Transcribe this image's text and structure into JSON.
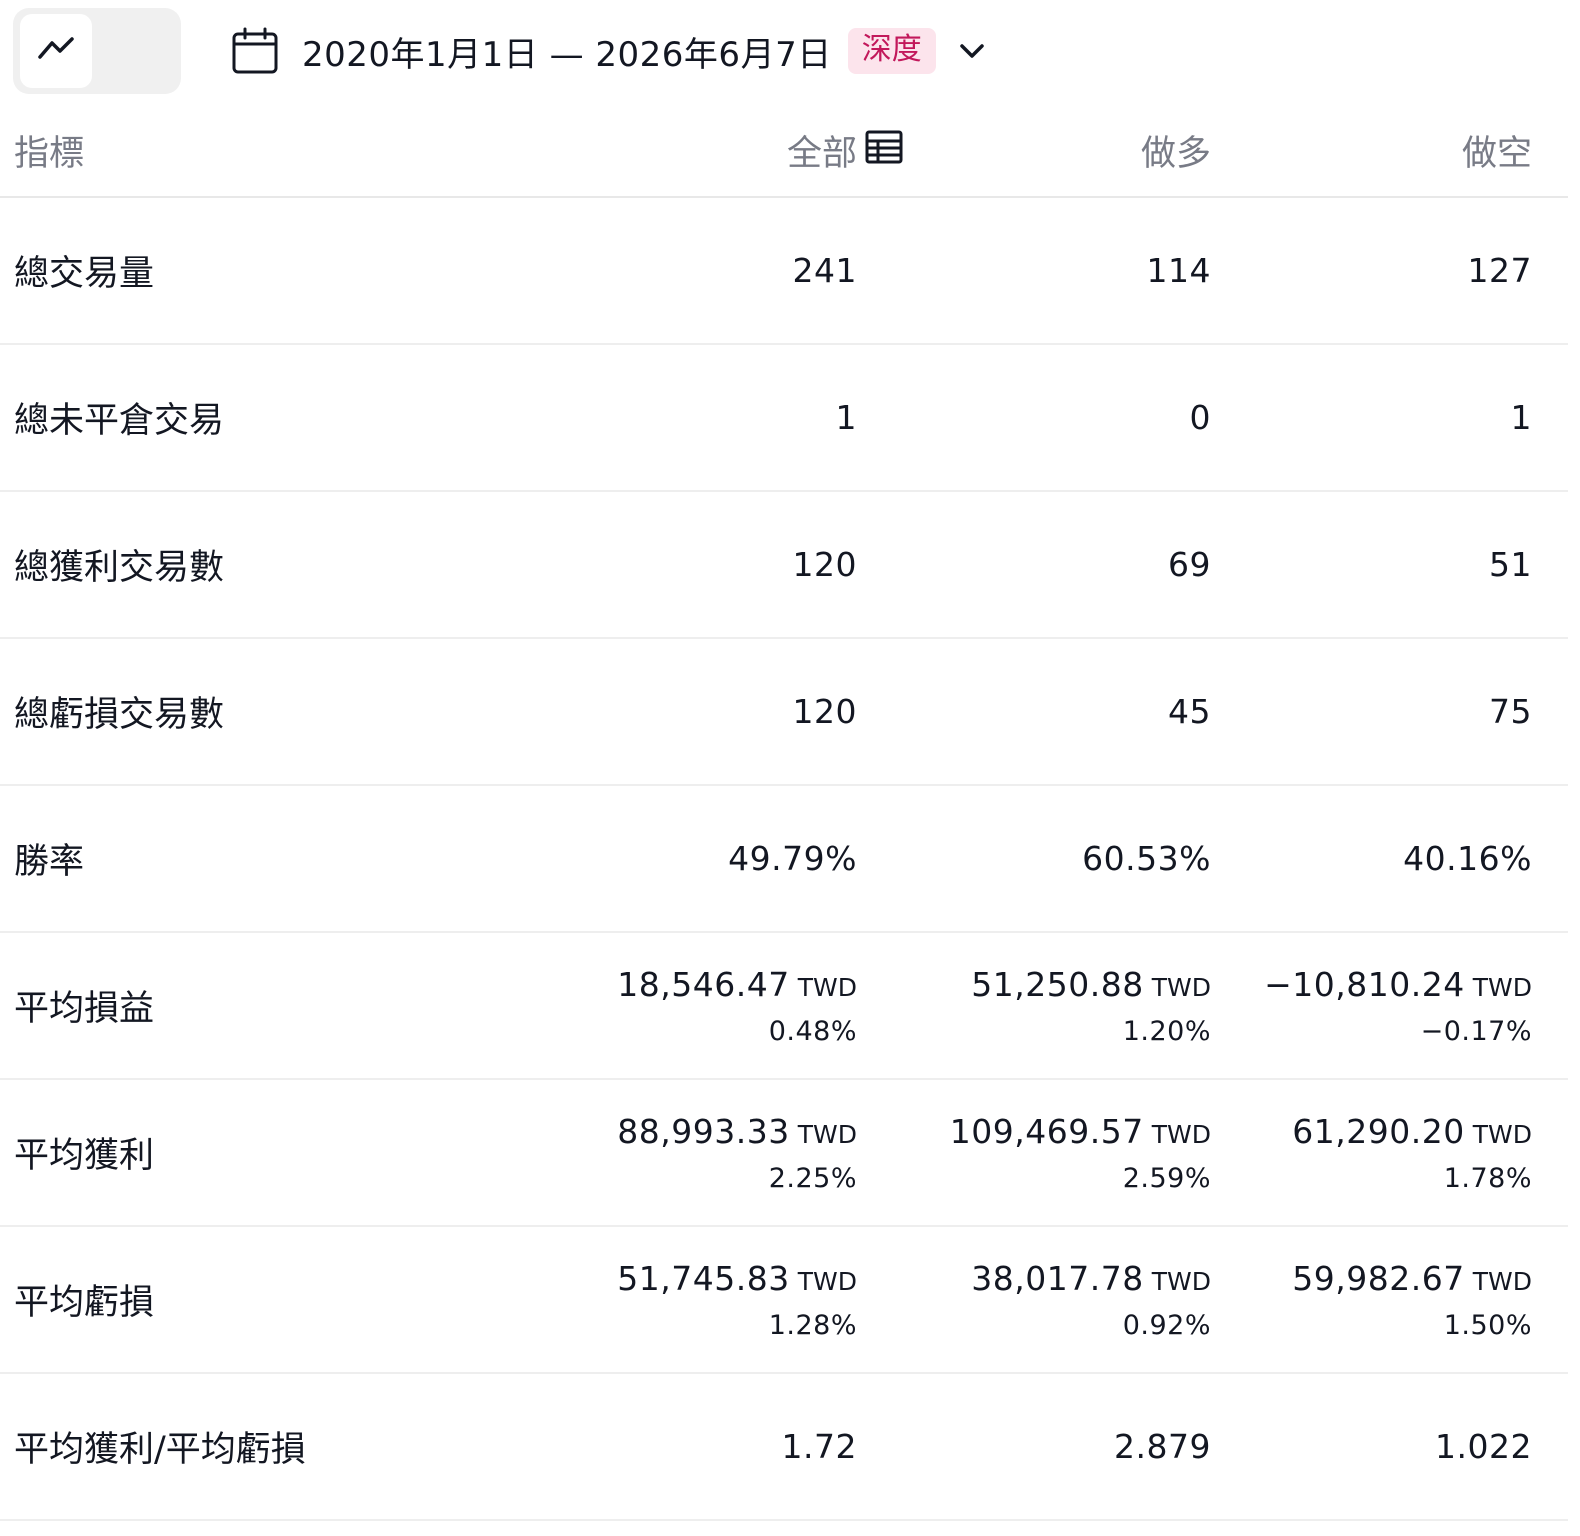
{
  "toolbar": {
    "view_toggle": {
      "chart_icon": "line-chart-icon",
      "table_icon": "table-icon",
      "active": "chart"
    },
    "date_range": {
      "icon": "calendar-icon",
      "text": "2020年1月1日 — 2026年6月7日",
      "badge": "深度",
      "dropdown_icon": "chevron-down-icon"
    }
  },
  "table": {
    "headers": {
      "metric": "指標",
      "all": "全部",
      "long": "做多",
      "short": "做空"
    },
    "rows": [
      {
        "label": "總交易量",
        "all": "241",
        "long": "114",
        "short": "127"
      },
      {
        "label": "總未平倉交易",
        "all": "1",
        "long": "0",
        "short": "1"
      },
      {
        "label": "總獲利交易數",
        "all": "120",
        "long": "69",
        "short": "51"
      },
      {
        "label": "總虧損交易數",
        "all": "120",
        "long": "45",
        "short": "75"
      },
      {
        "label": "勝率",
        "all": "49.79%",
        "long": "60.53%",
        "short": "40.16%"
      },
      {
        "label": "平均損益",
        "all": {
          "amount": "18,546.47",
          "currency": "TWD",
          "pct": "0.48%"
        },
        "long": {
          "amount": "51,250.88",
          "currency": "TWD",
          "pct": "1.20%"
        },
        "short": {
          "amount": "−10,810.24",
          "currency": "TWD",
          "pct": "−0.17%"
        }
      },
      {
        "label": "平均獲利",
        "all": {
          "amount": "88,993.33",
          "currency": "TWD",
          "pct": "2.25%"
        },
        "long": {
          "amount": "109,469.57",
          "currency": "TWD",
          "pct": "2.59%"
        },
        "short": {
          "amount": "61,290.20",
          "currency": "TWD",
          "pct": "1.78%"
        }
      },
      {
        "label": "平均虧損",
        "all": {
          "amount": "51,745.83",
          "currency": "TWD",
          "pct": "1.28%"
        },
        "long": {
          "amount": "38,017.78",
          "currency": "TWD",
          "pct": "0.92%"
        },
        "short": {
          "amount": "59,982.67",
          "currency": "TWD",
          "pct": "1.50%"
        }
      },
      {
        "label": "平均獲利/平均虧損",
        "all": "1.72",
        "long": "2.879",
        "short": "1.022"
      }
    ]
  },
  "colors": {
    "text": "#131722",
    "muted": "#787b86",
    "badge_bg": "#fce4ec",
    "badge_text": "#c2185b",
    "divider": "#eeeeee"
  }
}
